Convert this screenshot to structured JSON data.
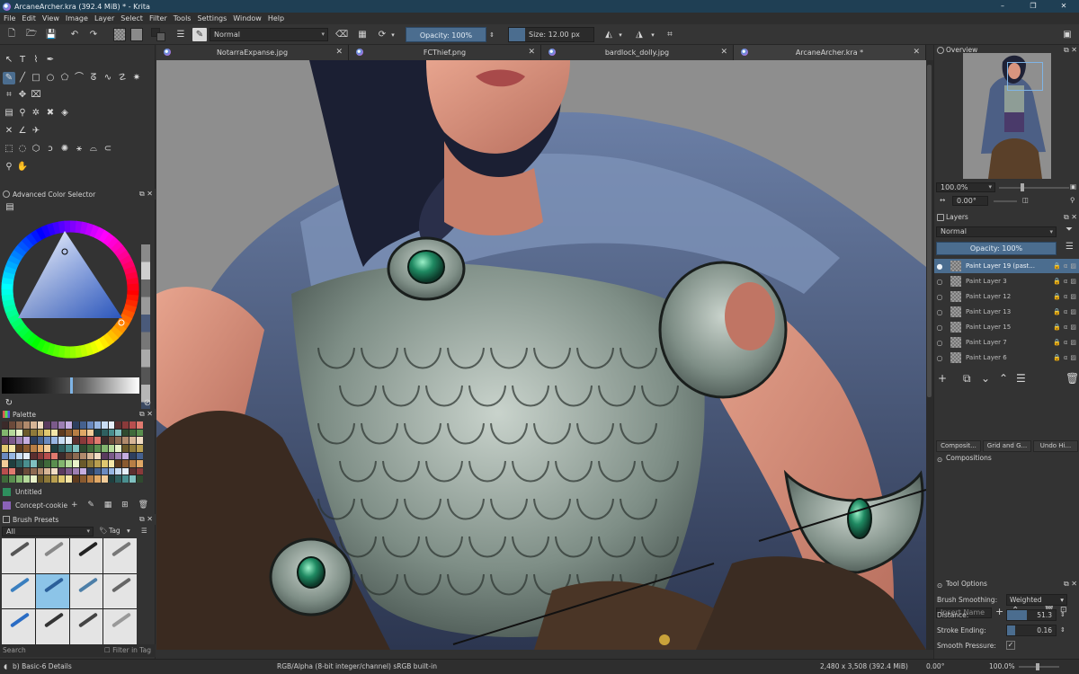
{
  "window": {
    "title": "ArcaneArcher.kra (392.4 MiB)  * - Krita",
    "controls": [
      "–",
      "❐",
      "✕"
    ]
  },
  "menu": [
    "File",
    "Edit",
    "View",
    "Image",
    "Layer",
    "Select",
    "Filter",
    "Tools",
    "Settings",
    "Window",
    "Help"
  ],
  "toolbar": {
    "blend_mode": "Normal",
    "opacity_label": "Opacity: 100%",
    "size_label": "Size: 12.00 px",
    "fg_color": "#2a2a2a",
    "bg_color": "#5c5c5c"
  },
  "tabs": [
    {
      "label": "NotarraExpanse.jpg",
      "close": "✕"
    },
    {
      "label": "FCThief.png",
      "close": "✕"
    },
    {
      "label": "bardlock_dolly.jpg",
      "close": "✕"
    },
    {
      "label": "ArcaneArcher.kra *",
      "close": "✕"
    }
  ],
  "left": {
    "color_selector_title": "Advanced Color Selector",
    "palette_title": "Palette",
    "palette_rows": [
      {
        "label": "Untitled",
        "color": "#2e8f5e"
      },
      {
        "label": "Concept-cookie",
        "color": "#8a62b8"
      }
    ],
    "brush_presets_title": "Brush Presets",
    "brush_filter": "All",
    "brush_tag": "Tag",
    "search_placeholder": "Search",
    "filter_in_tag": "Filter in Tag"
  },
  "right": {
    "overview_title": "Overview",
    "zoom": "100.0%",
    "rotation": "0.00°",
    "layers_title": "Layers",
    "layers_blend": "Normal",
    "layers_opacity": "Opacity:  100%",
    "layers": [
      {
        "name": "Paint Layer 19 (past...",
        "selected": true
      },
      {
        "name": "Paint Layer 3",
        "selected": false
      },
      {
        "name": "Paint Layer 12",
        "selected": false
      },
      {
        "name": "Paint Layer 13",
        "selected": false
      },
      {
        "name": "Paint Layer 15",
        "selected": false
      },
      {
        "name": "Paint Layer 7",
        "selected": false
      },
      {
        "name": "Paint Layer 6",
        "selected": false
      }
    ],
    "dock_tabs": [
      "Composit...",
      "Grid and G...",
      "Undo Hi..."
    ],
    "compositions_title": "Compositions",
    "insert_name_placeholder": "Insert Name",
    "tool_options_title": "Tool Options",
    "tool_options": {
      "smoothing_label": "Brush Smoothing:",
      "smoothing_value": "Weighted",
      "distance_label": "Distance:",
      "distance_value": "51.3",
      "stroke_ending_label": "Stroke Ending:",
      "stroke_ending_value": "0.16",
      "smooth_pressure_label": "Smooth Pressure:",
      "smooth_pressure_checked": "✓"
    }
  },
  "status": {
    "brush": "b) Basic-6 Details",
    "color_space": "RGB/Alpha (8-bit integer/channel)  sRGB built-in",
    "dimensions": "2,480 x 3,508 (392.4 MiB)",
    "rotation": "0.00°",
    "zoom": "100.0%"
  },
  "palette_colors": [
    "#3b2a2a",
    "#6b4a3a",
    "#8d6a52",
    "#b08a6c",
    "#d6b596",
    "#f1dcc3",
    "#5a3b5e",
    "#7b5a8a",
    "#9d7fb3",
    "#c5aee0",
    "#2d3f5e",
    "#45618f",
    "#6a8ac0",
    "#97b6e2",
    "#c8dcf3",
    "#e6eef8",
    "#5b2f2f",
    "#8a3a3a",
    "#b84e4e",
    "#e07a6f"
  ],
  "palette_colors2": [
    "#2f4a2f",
    "#3f6a3a",
    "#5a8f4f",
    "#82b56e",
    "#b5d99a",
    "#e8f2c9",
    "#6b5a2a",
    "#8f7a3a",
    "#b89e4f",
    "#e0c870",
    "#f5e6a8",
    "#5e3b1f",
    "#8a5a2f",
    "#b87e45",
    "#e0a866",
    "#f2cc99",
    "#1f3f3f",
    "#2f6060",
    "#4a8f8f",
    "#7fc0c0"
  ]
}
